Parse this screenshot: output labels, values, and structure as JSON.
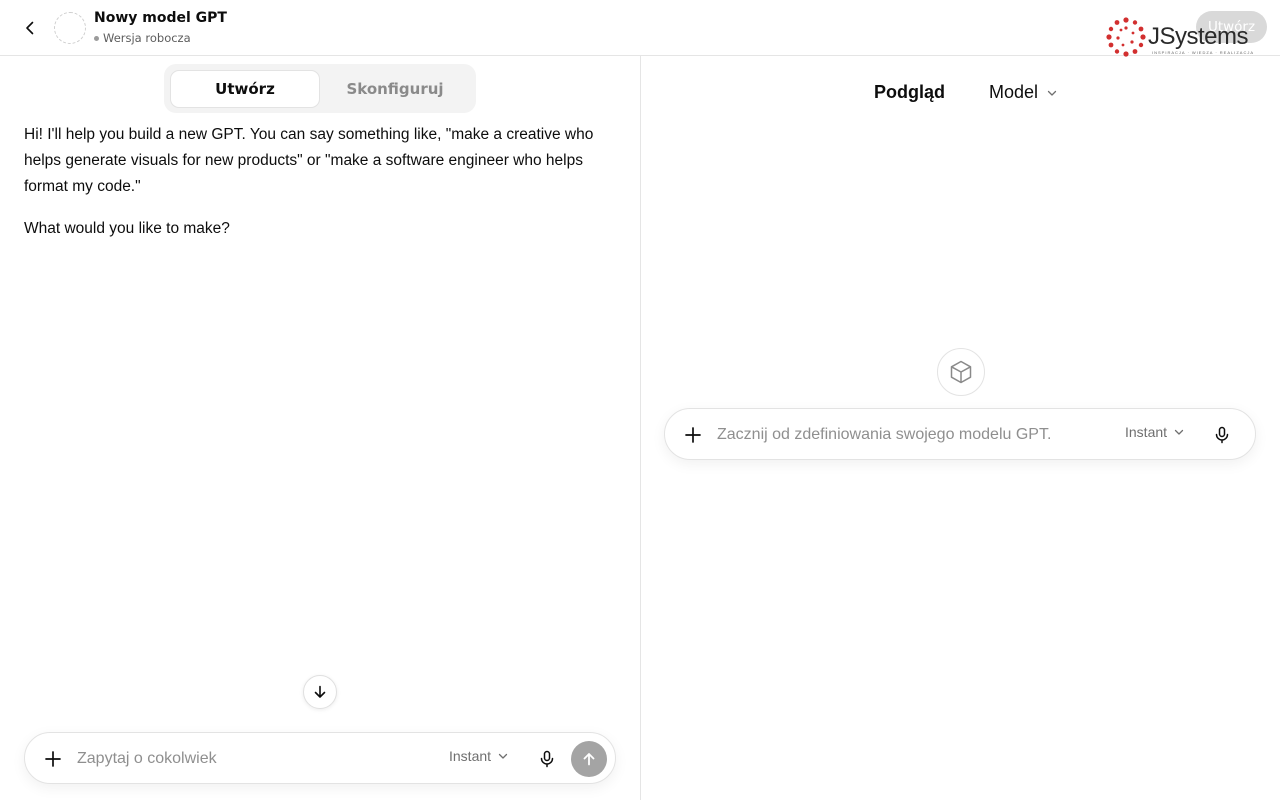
{
  "header": {
    "gpt_name": "Nowy model GPT",
    "status": "Wersja robocza",
    "create_button": "Utwórz"
  },
  "logo": {
    "brand": "JSystems",
    "tagline": "INSPIRACJA · WIEDZA · REALIZACJA"
  },
  "tabs": [
    {
      "label": "Utwórz",
      "active": true
    },
    {
      "label": "Skonfiguruj",
      "active": false
    }
  ],
  "builder_chat": {
    "messages": [
      "Hi! I'll help you build a new GPT. You can say something like, \"make a creative who helps generate visuals for new products\" or \"make a software engineer who helps format my code.\"",
      "What would you like to make?"
    ]
  },
  "left_composer": {
    "placeholder": "Zapytaj o cokolwiek",
    "mode": "Instant"
  },
  "preview": {
    "title": "Podgląd",
    "model_label": "Model",
    "composer": {
      "placeholder": "Zacznij od zdefiniowania swojego modelu GPT.",
      "mode": "Instant"
    }
  },
  "colors": {
    "text": "#0d0d0d",
    "muted": "#8f8f8f",
    "border": "#e5e5e5",
    "tabs_bg": "#f3f3f3",
    "send_disabled": "#a4a4a4",
    "logo_dots": "#d22f2f"
  },
  "icons": [
    "chevron-left-icon",
    "plus-icon",
    "chevron-down-icon",
    "mic-icon",
    "arrow-up-icon",
    "arrow-down-icon",
    "cube-icon"
  ]
}
